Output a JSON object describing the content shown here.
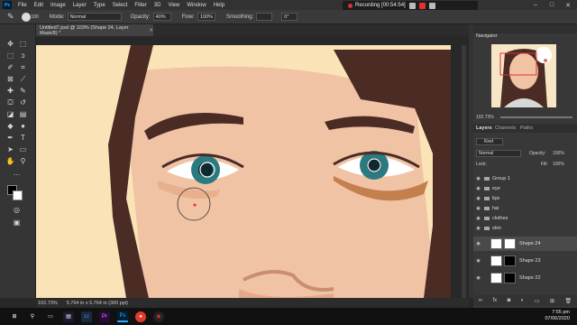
{
  "menu": [
    "File",
    "Edit",
    "Image",
    "Layer",
    "Type",
    "Select",
    "Filter",
    "3D",
    "View",
    "Window",
    "Help"
  ],
  "recording": {
    "label": "Recording [00:54:54]"
  },
  "options": {
    "mode_label": "Mode:",
    "mode_value": "Normal",
    "opacity_label": "Opacity:",
    "opacity_value": "40%",
    "flow_label": "Flow:",
    "flow_value": "100%",
    "smoothing_label": "Smoothing:",
    "smoothing_value": "",
    "angle_value": "0°",
    "brush_size": "100"
  },
  "document": {
    "tab_title": "Untitled7.psd @ 103% (Shape 24, Layer Mask/8) *",
    "zoom": "102.73%",
    "doc_size": "5.764 in x 5.764 in (300 ppi)"
  },
  "navigator": {
    "title": "Navigator",
    "zoom": "102.73%"
  },
  "layers_panel": {
    "tabs": [
      "Layers",
      "Channels",
      "Paths"
    ],
    "kind_label": "Kind",
    "blend_mode": "Normal",
    "opacity_label": "Opacity:",
    "opacity_value": "100%",
    "lock_label": "Lock:",
    "fill_label": "Fill:",
    "fill_value": "100%",
    "groups": [
      "Group 1",
      "eye",
      "lips",
      "hai",
      "clothes",
      "skin"
    ],
    "layers": [
      "Shape 24",
      "Shape 23",
      "Shape 22"
    ]
  },
  "taskbar": {
    "time": "7:55 pm",
    "date": "07/06/2020"
  },
  "colors": {
    "skin": "#f1c3a5",
    "hair": "#4a2c25",
    "iris": "#2a7a80",
    "bg_cream": "#f9e3b7"
  }
}
